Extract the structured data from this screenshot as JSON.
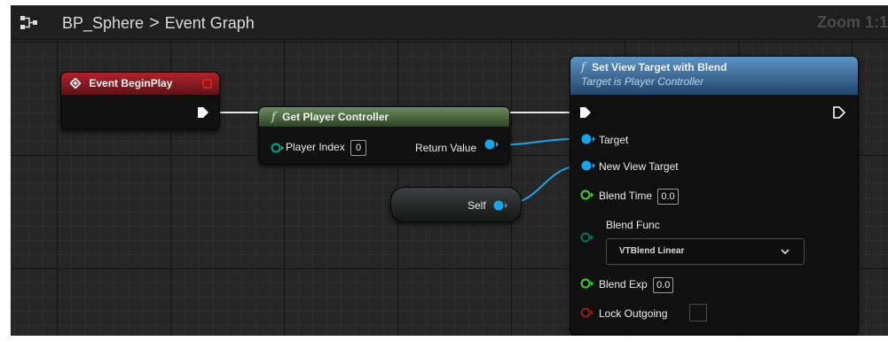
{
  "header": {
    "icon": "graph-icon",
    "breadcrumb_root": "BP_Sphere",
    "breadcrumb_separator": ">",
    "breadcrumb_current": "Event Graph",
    "zoom": "Zoom 1:1"
  },
  "nodes": {
    "event_begin_play": {
      "title": "Event BeginPlay"
    },
    "get_player_controller": {
      "func_icon": "f",
      "title": "Get Player Controller",
      "player_index_label": "Player Index",
      "player_index_value": "0",
      "return_value_label": "Return Value"
    },
    "self": {
      "label": "Self"
    },
    "set_view_target": {
      "func_icon": "f",
      "title": "Set View Target with Blend",
      "subtitle": "Target is Player Controller",
      "target_label": "Target",
      "new_view_target_label": "New View Target",
      "blend_time_label": "Blend Time",
      "blend_time_value": "0.0",
      "blend_func_label": "Blend Func",
      "blend_func_value": "VTBlend Linear",
      "blend_exp_label": "Blend Exp",
      "blend_exp_value": "0.0",
      "lock_outgoing_label": "Lock Outgoing",
      "lock_outgoing_checked": false
    }
  },
  "colors": {
    "exec_pin": "#ffffff",
    "object_pin": "#1fa3e8",
    "float_pin": "#3bd12a",
    "byte_pin": "#00715e",
    "bool_pin": "#9a1c1c",
    "event_header": "#b1232d",
    "pure_func_header": "#6c8c5c",
    "func_header": "#5c93c4"
  }
}
